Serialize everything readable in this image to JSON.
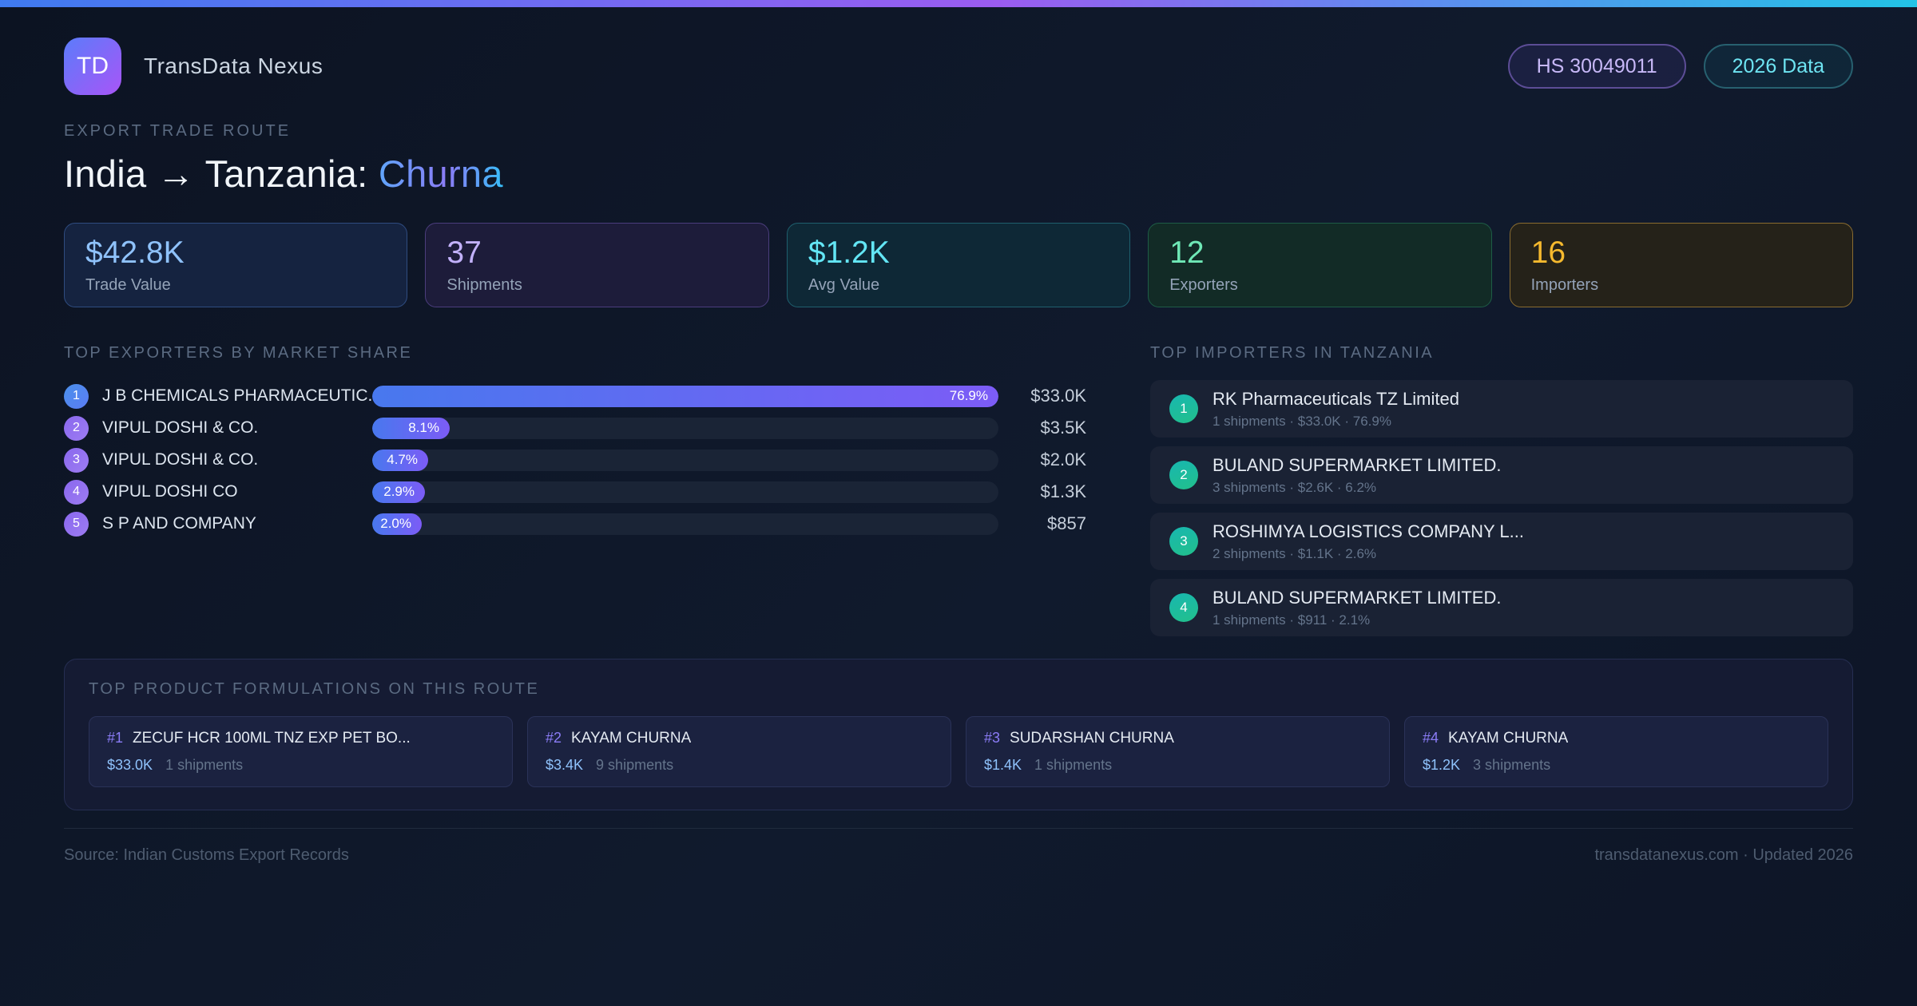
{
  "colors": {
    "accent_blue": "#3f7bf0",
    "accent_purple": "#9b5cf0",
    "accent_cyan": "#22c3e6",
    "stat_blue": "#8fc2fb",
    "stat_purple": "#c2b1fb",
    "stat_teal": "#63e6f5",
    "stat_green": "#6fe8b6",
    "stat_amber": "#f5b92e",
    "bar_gradient_start": "#4878ee",
    "bar_gradient_end": "#7c5cf6",
    "importer_badge": "#18b7a0"
  },
  "header": {
    "logo_text": "TD",
    "brand": "TransData Nexus",
    "badge_hs": "HS 30049011",
    "badge_year": "2026 Data"
  },
  "hero": {
    "eyebrow": "EXPORT TRADE ROUTE",
    "title_prefix": "India → Tanzania: ",
    "title_highlight": "Churna"
  },
  "stats": [
    {
      "value": "$42.8K",
      "label": "Trade Value"
    },
    {
      "value": "37",
      "label": "Shipments"
    },
    {
      "value": "$1.2K",
      "label": "Avg Value"
    },
    {
      "value": "12",
      "label": "Exporters"
    },
    {
      "value": "16",
      "label": "Importers"
    }
  ],
  "exporters": {
    "section_title": "TOP EXPORTERS BY MARKET SHARE",
    "rows": [
      {
        "rank": "1",
        "name": "J B CHEMICALS PHARMACEUTIC...",
        "pct": "76.9%",
        "value": "$33.0K",
        "bar_style": "width:100%"
      },
      {
        "rank": "2",
        "name": "VIPUL DOSHI & CO.",
        "pct": "8.1%",
        "value": "$3.5K",
        "bar_style": "width:97px"
      },
      {
        "rank": "3",
        "name": "VIPUL DOSHI & CO.",
        "pct": "4.7%",
        "value": "$2.0K",
        "bar_style": "width:70px"
      },
      {
        "rank": "4",
        "name": "VIPUL DOSHI CO",
        "pct": "2.9%",
        "value": "$1.3K",
        "bar_style": "width:66px"
      },
      {
        "rank": "5",
        "name": "S P AND COMPANY",
        "pct": "2.0%",
        "value": "$857",
        "bar_style": "width:62px"
      }
    ]
  },
  "importers": {
    "section_title": "TOP IMPORTERS IN TANZANIA",
    "rows": [
      {
        "rank": "1",
        "name": "RK Pharmaceuticals TZ Limited",
        "meta": "1 shipments · $33.0K · 76.9%"
      },
      {
        "rank": "2",
        "name": "BULAND SUPERMARKET LIMITED.",
        "meta": "3 shipments · $2.6K · 6.2%"
      },
      {
        "rank": "3",
        "name": "ROSHIMYA LOGISTICS COMPANY L...",
        "meta": "2 shipments · $1.1K · 2.6%"
      },
      {
        "rank": "4",
        "name": "BULAND SUPERMARKET LIMITED.",
        "meta": "1 shipments · $911 · 2.1%"
      }
    ]
  },
  "products": {
    "section_title": "TOP PRODUCT FORMULATIONS ON THIS ROUTE",
    "cards": [
      {
        "rank": "#1",
        "name": "ZECUF HCR 100ML TNZ EXP PET BO...",
        "value": "$33.0K",
        "shipments": "1 shipments"
      },
      {
        "rank": "#2",
        "name": "KAYAM CHURNA",
        "value": "$3.4K",
        "shipments": "9 shipments"
      },
      {
        "rank": "#3",
        "name": "SUDARSHAN CHURNA",
        "value": "$1.4K",
        "shipments": "1 shipments"
      },
      {
        "rank": "#4",
        "name": "KAYAM CHURNA",
        "value": "$1.2K",
        "shipments": "3 shipments"
      }
    ]
  },
  "footer": {
    "left": "Source: Indian Customs Export Records",
    "right": "transdatanexus.com · Updated 2026"
  }
}
